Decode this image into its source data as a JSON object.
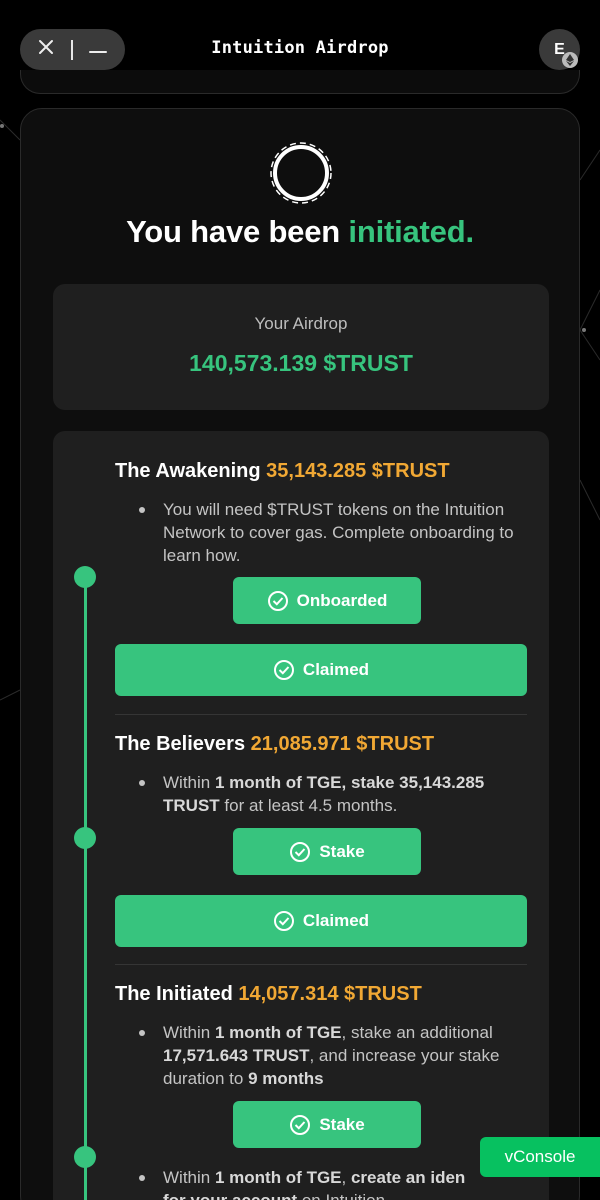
{
  "header": {
    "title": "Intuition Airdrop",
    "close_icon": "close-icon",
    "minimize_icon": "minimize-icon",
    "avatar_letter": "E",
    "avatar_badge_icon": "ethereum-icon"
  },
  "hero": {
    "icon": "ring-icon",
    "headline_prefix": "You have been ",
    "headline_accent": "initiated."
  },
  "airdrop": {
    "label": "Your Airdrop",
    "amount": "140,573.139 $TRUST"
  },
  "tiers": [
    {
      "name": "The Awakening",
      "amount": "35,143.285 $TRUST",
      "bullet": "You will need $TRUST tokens on the Intuition Network to cover gas. Complete onboarding to learn how.",
      "step_button": "Onboarded",
      "claim_button": "Claimed"
    },
    {
      "name": "The Believers",
      "amount": "21,085.971 $TRUST",
      "bullet_parts": [
        "Within ",
        "1 month of TGE, stake 35,143.285 TRUST",
        " for at least 4.5 months."
      ],
      "step_button": "Stake",
      "claim_button": "Claimed"
    },
    {
      "name": "The Initiated",
      "amount": "14,057.314 $TRUST",
      "bullet_parts": [
        "Within ",
        "1 month of TGE",
        ", stake an additional ",
        "17,571.643 TRUST",
        ", and increase your stake duration to ",
        "9 months"
      ],
      "step_button": "Stake",
      "bullet2_parts": [
        "Within ",
        "1 month of TGE",
        ", ",
        "create an iden",
        "for your account",
        " on Intuition"
      ]
    }
  ],
  "vconsole": "vConsole",
  "colors": {
    "accent_green": "#37c47e",
    "amount_orange": "#f1a834",
    "card_bg": "#1f1f1f",
    "vconsole_green": "#07c160"
  }
}
